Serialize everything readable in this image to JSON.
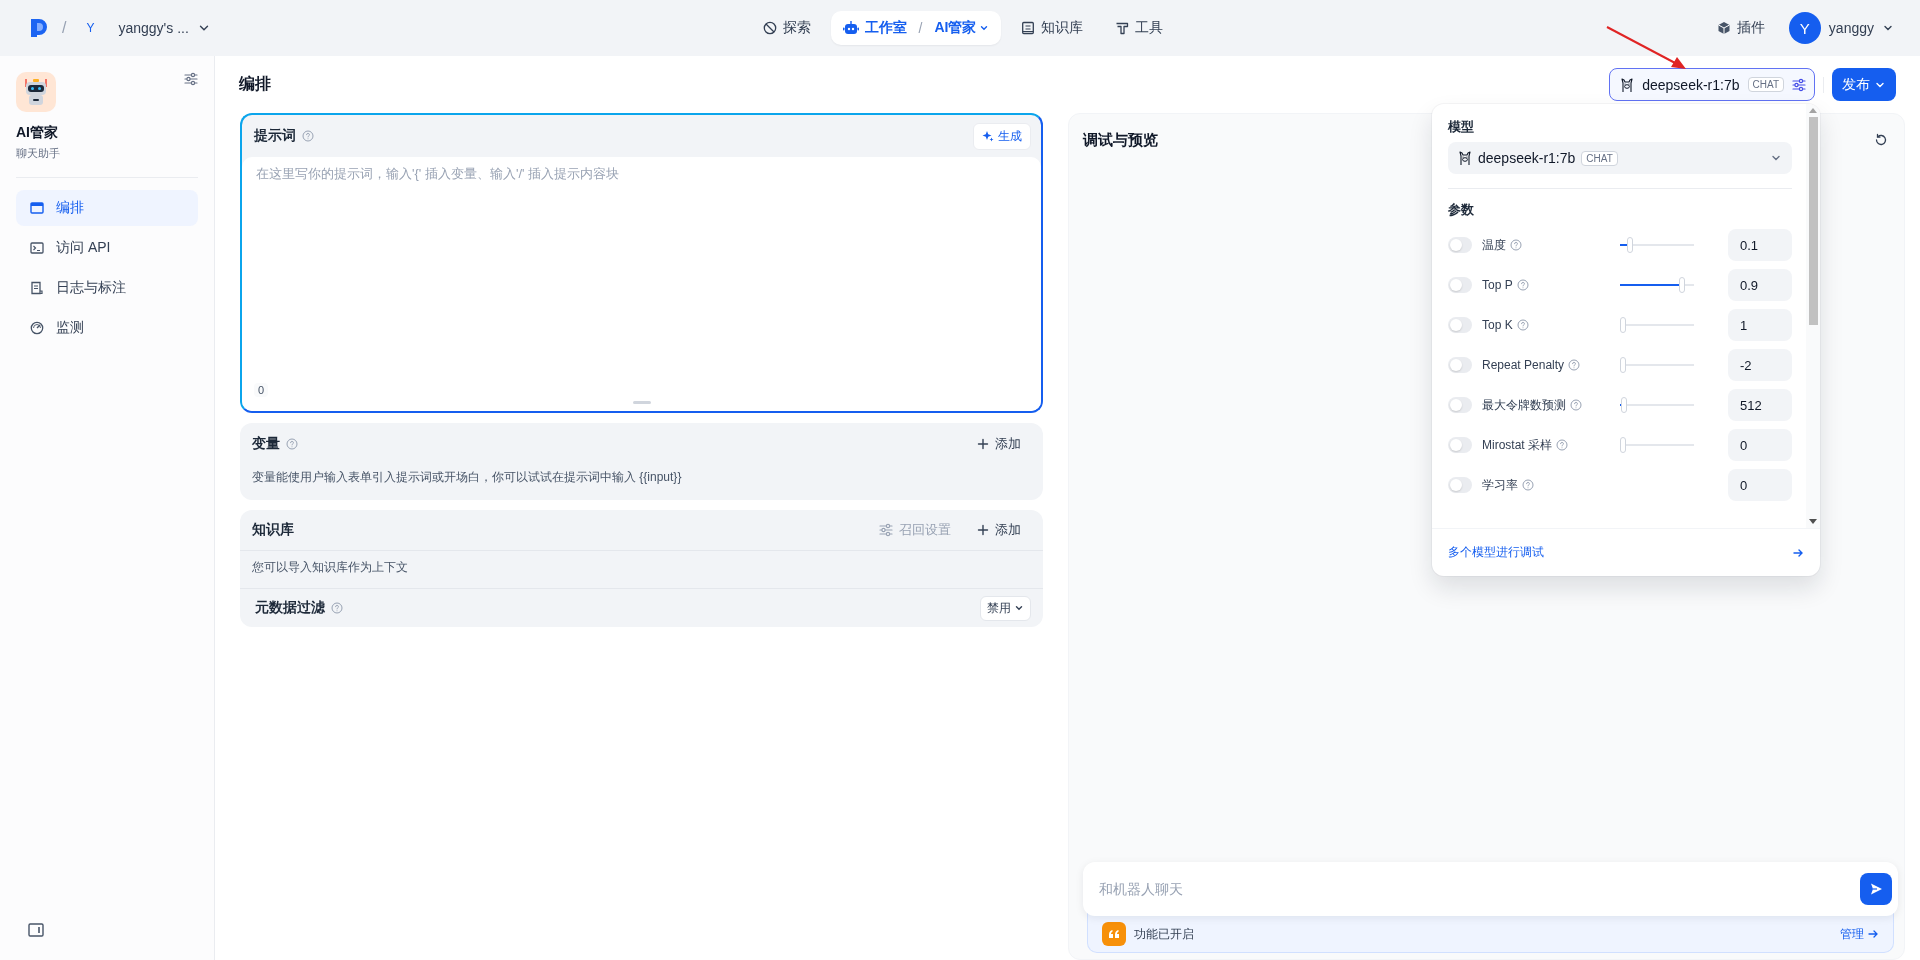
{
  "topbar": {
    "workspace": {
      "separator": "/",
      "initial": "Y",
      "name": "yanggy's ..."
    },
    "nav": [
      {
        "label": "探索",
        "selected": false
      },
      {
        "label": "工作室",
        "selected": true,
        "separator": "/",
        "sub": "AI管家"
      },
      {
        "label": "知识库",
        "selected": false
      },
      {
        "label": "工具",
        "selected": false
      }
    ],
    "plugins": "插件",
    "user_initial": "Y",
    "user_name": "yanggy"
  },
  "sidebar": {
    "app_name": "AI管家",
    "app_type": "聊天助手",
    "items": [
      {
        "label": "编排",
        "selected": true
      },
      {
        "label": "访问 API",
        "selected": false
      },
      {
        "label": "日志与标注",
        "selected": false
      },
      {
        "label": "监测",
        "selected": false
      }
    ]
  },
  "header": {
    "title": "编排",
    "model_name": "deepseek-r1:7b",
    "model_mode": "CHAT",
    "publish": "发布"
  },
  "prompt": {
    "title": "提示词",
    "generate": "生成",
    "placeholder": "在这里写你的提示词，输入'{' 插入变量、输入'/' 插入提示内容块",
    "count": "0"
  },
  "variables": {
    "title": "变量",
    "add": "添加",
    "hint": "变量能使用户输入表单引入提示词或开场白，你可以试试在提示词中输入 {{input}}"
  },
  "knowledge": {
    "title": "知识库",
    "retrieval": {
      "label": "召回设置",
      "disabled": true
    },
    "add": "添加",
    "hint": "您可以导入知识库作为上下文",
    "filter_label": "元数据过滤",
    "filter_value": "禁用"
  },
  "debug": {
    "title": "调试与预览",
    "chat_placeholder": "和机器人聊天",
    "feature_text": "功能已开启",
    "manage": "管理"
  },
  "model_popup": {
    "model_label": "模型",
    "model_name": "deepseek-r1:7b",
    "model_mode": "CHAT",
    "params_label": "参数",
    "params": [
      {
        "kind": "slider",
        "label": "温度",
        "on": false,
        "level": 0.1,
        "value": "0.1"
      },
      {
        "kind": "slider",
        "label": "Top P",
        "on": false,
        "level": 0.87,
        "value": "0.9"
      },
      {
        "kind": "slider",
        "label": "Top K",
        "on": false,
        "level": 0,
        "value": "1"
      },
      {
        "kind": "slider",
        "label": "Repeat Penalty",
        "on": false,
        "level": 0,
        "value": "-2"
      },
      {
        "kind": "slider",
        "label": "最大令牌数预测",
        "on": false,
        "level": 0.01,
        "value": "512"
      },
      {
        "kind": "slider",
        "label": "Mirostat 采样",
        "on": false,
        "level": 0,
        "value": "0"
      },
      {
        "kind": "plain",
        "label": "学习率",
        "on": false,
        "value": "0"
      }
    ],
    "multi_model": "多个模型进行调试"
  }
}
